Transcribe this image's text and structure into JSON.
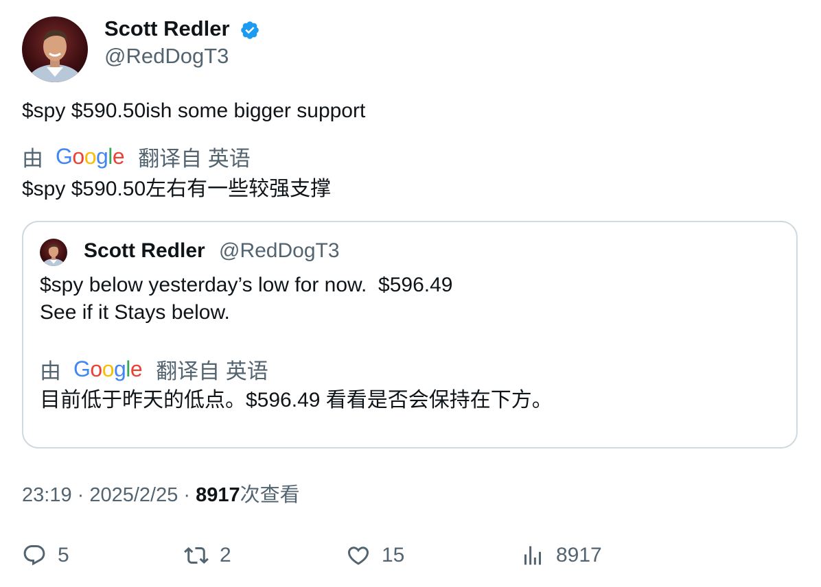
{
  "author": {
    "name": "Scott Redler",
    "handle": "@RedDogT3",
    "verified": true,
    "avatar": "avatar-photo-man-smiling"
  },
  "tweet": {
    "text": "$spy $590.50ish some bigger support",
    "translate_by": "由",
    "translate_brand": "Google",
    "translate_from": "翻译自 英语",
    "translated_text": "$spy $590.50左右有一些较强支撑"
  },
  "quote": {
    "name": "Scott Redler",
    "handle": "@RedDogT3",
    "text": "$spy below yesterday’s low for now.  $596.49\nSee if it Stays below.",
    "translate_by": "由",
    "translate_brand": "Google",
    "translate_from": "翻译自 英语",
    "translated_text": "目前低于昨天的低点。$596.49 看看是否会保持在下方。"
  },
  "meta": {
    "time": "23:19",
    "separator1": " · ",
    "date": "2025/2/25",
    "separator2": " · ",
    "views_count": "8917",
    "views_label": "次查看"
  },
  "actions": {
    "reply_count": "5",
    "retweet_count": "2",
    "like_count": "15",
    "views_count": "8917"
  },
  "colors": {
    "text_primary": "#0f1419",
    "text_secondary": "#536471",
    "verified_blue": "#1d9bf0",
    "border": "#cfd9de"
  }
}
